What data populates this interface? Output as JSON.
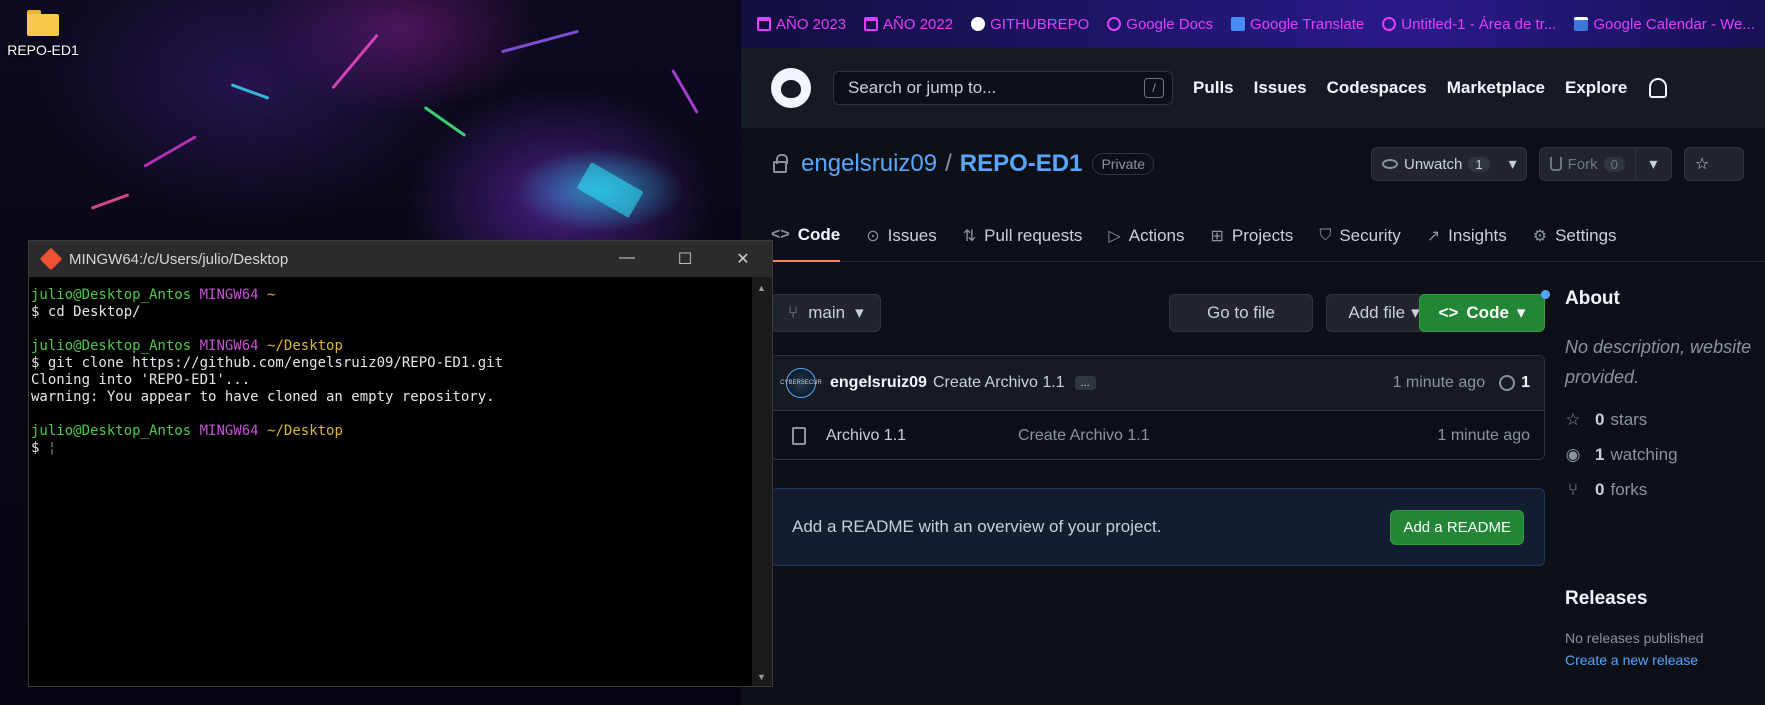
{
  "desktop": {
    "icon_label": "REPO-ED1"
  },
  "terminal": {
    "title": "MINGW64:/c/Users/julio/Desktop",
    "lines": {
      "l1_user": "julio@Desktop_Antos",
      "l1_host": "MINGW64",
      "l1_path": "~",
      "l2": "$ cd Desktop/",
      "l3_user": "julio@Desktop_Antos",
      "l3_host": "MINGW64",
      "l3_path": "~/Desktop",
      "l4": "$ git clone https://github.com/engelsruiz09/REPO-ED1.git",
      "l5": "Cloning into 'REPO-ED1'...",
      "l6": "warning: You appear to have cloned an empty repository.",
      "l7_user": "julio@Desktop_Antos",
      "l7_host": "MINGW64",
      "l7_path": "~/Desktop",
      "l8": "$ "
    }
  },
  "bookmarks": [
    {
      "label": "AÑO 2023",
      "icon": "folder-icon"
    },
    {
      "label": "AÑO 2022",
      "icon": "folder-icon"
    },
    {
      "label": "GITHUBREPO",
      "icon": "github-icon"
    },
    {
      "label": "Google Docs",
      "icon": "globe-icon"
    },
    {
      "label": "Google Translate",
      "icon": "google-translate-icon"
    },
    {
      "label": "Untitled-1 - Área de tr...",
      "icon": "globe-icon"
    },
    {
      "label": "Google Calendar - We...",
      "icon": "calendar-icon"
    }
  ],
  "header": {
    "search_placeholder": "Search or jump to...",
    "search_shortcut": "/",
    "nav": [
      "Pulls",
      "Issues",
      "Codespaces",
      "Marketplace",
      "Explore"
    ]
  },
  "repo": {
    "owner": "engelsruiz09",
    "separator": "/",
    "name": "REPO-ED1",
    "visibility": "Private",
    "watch_label": "Unwatch",
    "watch_count": "1",
    "fork_label": "Fork",
    "fork_count": "0"
  },
  "tabs": [
    {
      "label": "Code",
      "icon": "code-icon"
    },
    {
      "label": "Issues",
      "icon": "issue-icon"
    },
    {
      "label": "Pull requests",
      "icon": "pull-request-icon"
    },
    {
      "label": "Actions",
      "icon": "play-icon"
    },
    {
      "label": "Projects",
      "icon": "table-icon"
    },
    {
      "label": "Security",
      "icon": "shield-icon"
    },
    {
      "label": "Insights",
      "icon": "graph-icon"
    },
    {
      "label": "Settings",
      "icon": "gear-icon"
    }
  ],
  "toolbar": {
    "branch": "main",
    "go_to_file": "Go to file",
    "add_file": "Add file",
    "code": "Code"
  },
  "commit": {
    "avatar_text": "CYBERSECUR",
    "author": "engelsruiz09",
    "message": "Create Archivo 1.1",
    "ellipsis": "...",
    "time": "1 minute ago",
    "history_count": "1"
  },
  "files": [
    {
      "name": "Archivo 1.1",
      "message": "Create Archivo 1.1",
      "time": "1 minute ago"
    }
  ],
  "readme": {
    "text": "Add a README with an overview of your project.",
    "button": "Add a README"
  },
  "about": {
    "title": "About",
    "description_line1": "No description, website",
    "description_line2": "provided.",
    "stars_count": "0",
    "stars_label": "stars",
    "watching_count": "1",
    "watching_label": "watching",
    "forks_count": "0",
    "forks_label": "forks"
  },
  "releases": {
    "title": "Releases",
    "none": "No releases published",
    "create_link": "Create a new release"
  }
}
